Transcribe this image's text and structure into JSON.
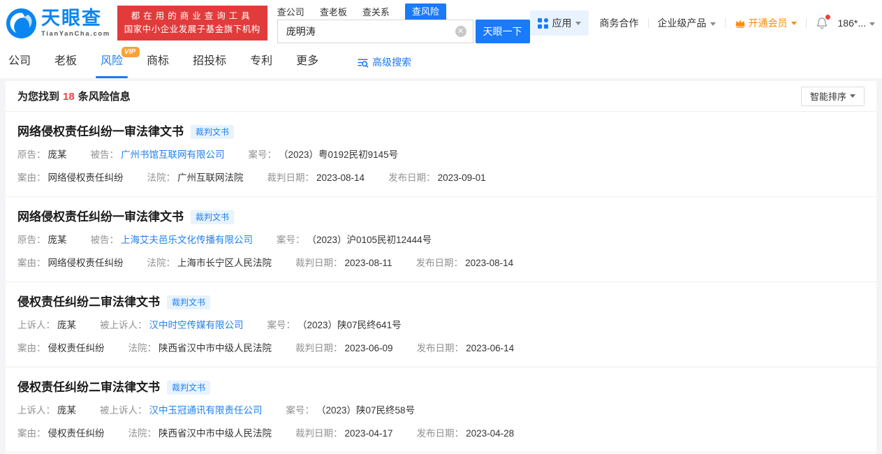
{
  "colors": {
    "accent_blue": "#1a7af8",
    "link_blue": "#2080f0",
    "banner_red": "#e23b3b",
    "count_red": "#f53f3f",
    "vip_orange": "#ff8b00",
    "badge_orange": "#f7a23b"
  },
  "header": {
    "logo": {
      "title": "天眼查",
      "subtitle": "TianYanCha.com"
    },
    "banner": {
      "line1": "都在用的商业查询工具",
      "line2": "国家中小企业发展子基金旗下机构"
    },
    "search": {
      "tabs": [
        {
          "label": "查公司",
          "active": false
        },
        {
          "label": "查老板",
          "active": false
        },
        {
          "label": "查关系",
          "active": false
        },
        {
          "label": "查风险",
          "active": true
        }
      ],
      "value": "庞明涛",
      "clear_icon": "circle-x-icon",
      "button": "天眼一下"
    },
    "menu": {
      "apps": "应用",
      "cooperation": "商务合作",
      "enterprise": "企业级产品",
      "vip": "开通会员",
      "phone": "186*..."
    }
  },
  "nav": {
    "tabs": [
      {
        "label": "公司",
        "active": false
      },
      {
        "label": "老板",
        "active": false
      },
      {
        "label": "风险",
        "active": true,
        "badge": "VIP"
      },
      {
        "label": "商标",
        "active": false
      },
      {
        "label": "招投标",
        "active": false
      },
      {
        "label": "专利",
        "active": false
      },
      {
        "label": "更多",
        "active": false
      }
    ],
    "advanced_search": "高级搜索"
  },
  "results": {
    "prefix": "为您找到",
    "count": "18",
    "suffix": "条风险信息",
    "sort": "智能排序"
  },
  "cards": [
    {
      "title": "网络侵权责任纠纷一审法律文书",
      "badge": "裁判文书",
      "row1": [
        {
          "label": "原告：",
          "value": "庞某"
        },
        {
          "label": "被告：",
          "value": "广州书馆互联网有限公司"
        },
        {
          "label": "案号：",
          "value": "（2023）粤0192民初9145号"
        }
      ],
      "row2": [
        {
          "label": "案由：",
          "value": "网络侵权责任纠纷"
        },
        {
          "label": "法院：",
          "value": "广州互联网法院"
        },
        {
          "label": "裁判日期：",
          "value": "2023-08-14"
        },
        {
          "label": "发布日期：",
          "value": "2023-09-01"
        }
      ]
    },
    {
      "title": "网络侵权责任纠纷一审法律文书",
      "badge": "裁判文书",
      "row1": [
        {
          "label": "原告：",
          "value": "庞某"
        },
        {
          "label": "被告：",
          "value": "上海艾夫邑乐文化传播有限公司"
        },
        {
          "label": "案号：",
          "value": "（2023）沪0105民初12444号"
        }
      ],
      "row2": [
        {
          "label": "案由：",
          "value": "网络侵权责任纠纷"
        },
        {
          "label": "法院：",
          "value": "上海市长宁区人民法院"
        },
        {
          "label": "裁判日期：",
          "value": "2023-08-11"
        },
        {
          "label": "发布日期：",
          "value": "2023-08-14"
        }
      ]
    },
    {
      "title": "侵权责任纠纷二审法律文书",
      "badge": "裁判文书",
      "row1": [
        {
          "label": "上诉人：",
          "value": "庞某"
        },
        {
          "label": "被上诉人：",
          "value": "汉中时空传媒有限公司"
        },
        {
          "label": "案号：",
          "value": "（2023）陕07民终641号"
        }
      ],
      "row2": [
        {
          "label": "案由：",
          "value": "侵权责任纠纷"
        },
        {
          "label": "法院：",
          "value": "陕西省汉中市中级人民法院"
        },
        {
          "label": "裁判日期：",
          "value": "2023-06-09"
        },
        {
          "label": "发布日期：",
          "value": "2023-06-14"
        }
      ]
    },
    {
      "title": "侵权责任纠纷二审法律文书",
      "badge": "裁判文书",
      "row1": [
        {
          "label": "上诉人：",
          "value": "庞某"
        },
        {
          "label": "被上诉人：",
          "value": "汉中玉冠通讯有限责任公司"
        },
        {
          "label": "案号：",
          "value": "（2023）陕07民终58号"
        }
      ],
      "row2": [
        {
          "label": "案由：",
          "value": "侵权责任纠纷"
        },
        {
          "label": "法院：",
          "value": "陕西省汉中市中级人民法院"
        },
        {
          "label": "裁判日期：",
          "value": "2023-04-17"
        },
        {
          "label": "发布日期：",
          "value": "2023-04-28"
        }
      ]
    }
  ]
}
